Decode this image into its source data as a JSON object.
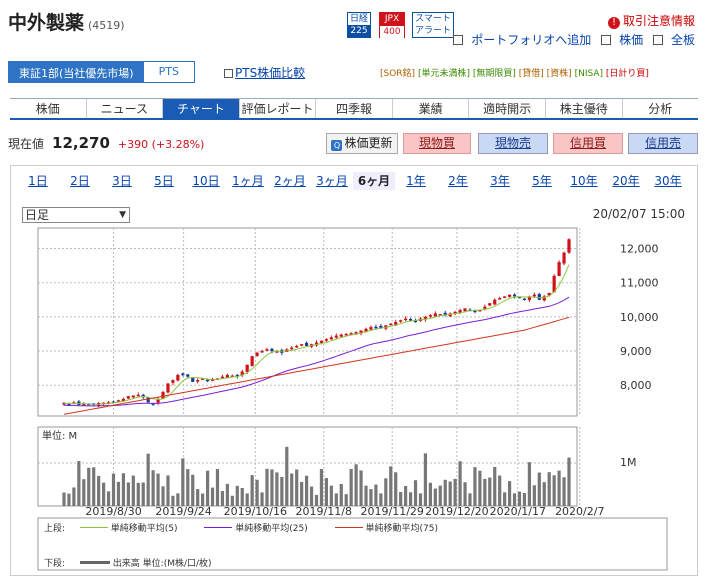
{
  "header": {
    "title": "中外製薬",
    "code": "(4519)",
    "logos": [
      {
        "top": "日経",
        "bottom": "225"
      },
      {
        "top": "JPX",
        "bottom": "400"
      },
      {
        "top": "スマート",
        "bottom": "アラート"
      }
    ],
    "alert": "取引注意情報",
    "links": [
      "ポートフォリオへ追加",
      "株価",
      "全板"
    ]
  },
  "market_tabs": {
    "active": "東証1部(当社優先市場)",
    "other": "PTS",
    "compare_link": "PTS株価比較"
  },
  "tags": [
    "[SOR銘]",
    "[単元未満株]",
    "[無期限買]",
    "[貸借]",
    "[資株]",
    "[NISA]",
    "[日計り買]"
  ],
  "nav": [
    "株価",
    "ニュース",
    "チャート",
    "評価レポート",
    "四季報",
    "業績",
    "適時開示",
    "株主優待",
    "分析"
  ],
  "nav_active": "チャート",
  "quote": {
    "label": "現在値",
    "price": "12,270",
    "change": "+390 (+3.28%)"
  },
  "buttons": {
    "refresh": "株価更新",
    "actual_buy": "現物買",
    "actual_sell": "現物売",
    "margin_buy": "信用買",
    "margin_sell": "信用売"
  },
  "periods": [
    "1日",
    "2日",
    "3日",
    "5日",
    "10日",
    "1ヶ月",
    "2ヶ月",
    "3ヶ月",
    "6ヶ月",
    "1年",
    "2年",
    "3年",
    "5年",
    "10年",
    "20年",
    "30年"
  ],
  "period_selected": "6ヶ月",
  "chart_select": "日足",
  "datetime": "20/02/07 15:00",
  "colors": {
    "accent": "#1a5bb5",
    "up": "#d0121b",
    "down": "#1a3b9b",
    "ma5": "#8cc63f",
    "ma25": "#7a1fd6",
    "ma75": "#d2351f"
  },
  "chart_data": {
    "type": "candlestick",
    "price_axis": {
      "ticks": [
        "12,000",
        "11,000",
        "10,000",
        "9,000",
        "8,000"
      ],
      "values": [
        12000,
        11000,
        10000,
        9000,
        8000
      ],
      "ylim": [
        7100,
        12600
      ]
    },
    "x_tick_labels": [
      "2019/8/30",
      "2019/9/24",
      "2019/10/16",
      "2019/11/8",
      "2019/11/29",
      "2019/12/20",
      "2020/1/17",
      "2020/2/7"
    ],
    "close_path": [
      7480,
      7450,
      7500,
      7420,
      7460,
      7430,
      7420,
      7480,
      7490,
      7500,
      7520,
      7560,
      7600,
      7680,
      7700,
      7720,
      7650,
      7500,
      7450,
      7600,
      7800,
      8050,
      8150,
      8300,
      8320,
      8250,
      8100,
      8150,
      8200,
      8150,
      8180,
      8200,
      8250,
      8300,
      8280,
      8250,
      8400,
      8600,
      8850,
      8950,
      9000,
      9050,
      9000,
      9000,
      8950,
      9050,
      9100,
      9150,
      9200,
      9150,
      9200,
      9250,
      9300,
      9350,
      9400,
      9450,
      9480,
      9500,
      9520,
      9550,
      9600,
      9650,
      9700,
      9700,
      9680,
      9750,
      9800,
      9850,
      9900,
      9950,
      9900,
      9880,
      9950,
      10000,
      10050,
      10100,
      10080,
      10050,
      10100,
      10150,
      10200,
      10250,
      10200,
      10150,
      10200,
      10300,
      10400,
      10500,
      10550,
      10600,
      10650,
      10600,
      10550,
      10500,
      10600,
      10650,
      10500,
      10600,
      10700,
      11200,
      11600,
      11880,
      12270
    ],
    "ma_legend_top": {
      "label": "上段:",
      "ma5": "単純移動平均(5)",
      "ma25": "単純移動平均(25)",
      "ma75": "単純移動平均(75)"
    },
    "volume": {
      "unit_label": "単位: M",
      "tick": "1M",
      "legend_label": "下段:",
      "legend": "出来高 単位:(M株/口/枚)"
    }
  }
}
